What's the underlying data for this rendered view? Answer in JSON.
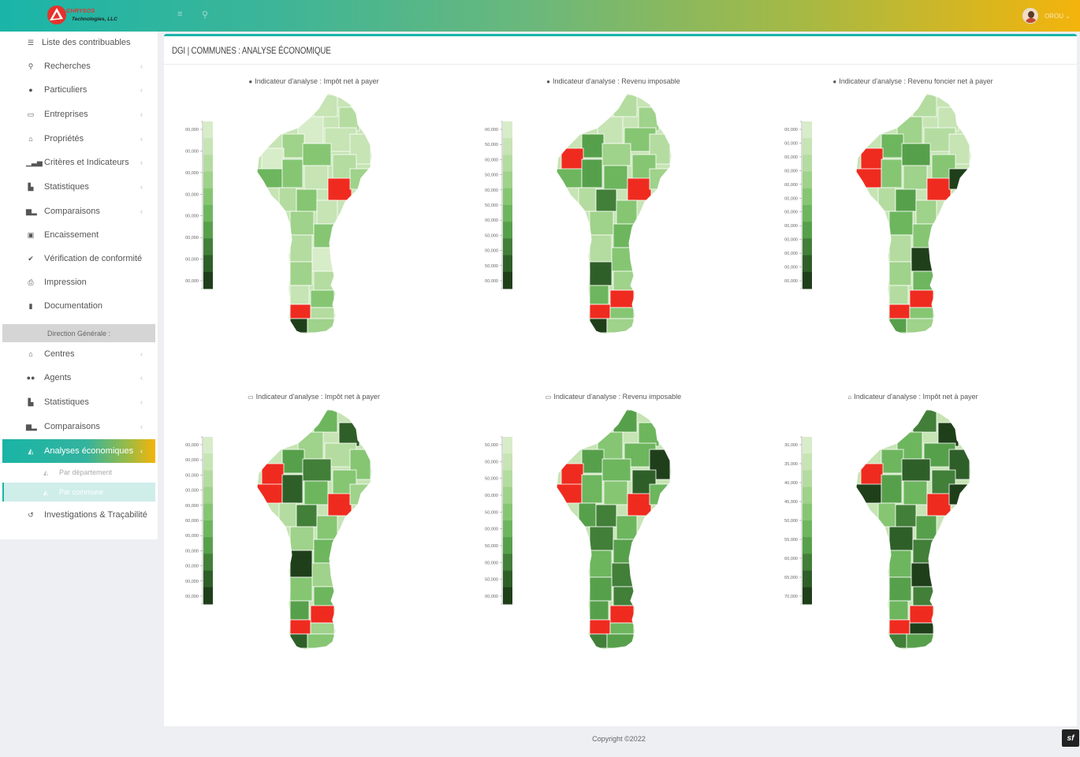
{
  "header": {
    "logo_line1": "CHRYSOS",
    "logo_line2": "Technologies, LLC",
    "menu_icon": "bars-icon",
    "search_icon": "search-icon",
    "user_name": "OROU",
    "user_caret": "⌄"
  },
  "sidebar": {
    "items": [
      {
        "label": "Liste des contribuables",
        "icon": "list-icon",
        "chevron": false
      },
      {
        "label": "Recherches",
        "icon": "search-icon",
        "chevron": true
      },
      {
        "label": "Particuliers",
        "icon": "user-icon",
        "chevron": true
      },
      {
        "label": "Entreprises",
        "icon": "desktop-icon",
        "chevron": true
      },
      {
        "label": "Propriétés",
        "icon": "home-icon",
        "chevron": true
      },
      {
        "label": "Critères et Indicateurs",
        "icon": "signal-icon",
        "chevron": true
      },
      {
        "label": "Statistiques",
        "icon": "bar-chart-icon",
        "chevron": true
      },
      {
        "label": "Comparaisons",
        "icon": "bar-compare-icon",
        "chevron": true
      },
      {
        "label": "Encaissement",
        "icon": "money-icon",
        "chevron": false
      },
      {
        "label": "Vérification de conformité",
        "icon": "check-circle-icon",
        "chevron": false
      },
      {
        "label": "Impression",
        "icon": "print-icon",
        "chevron": false
      },
      {
        "label": "Documentation",
        "icon": "bookmark-icon",
        "chevron": false
      }
    ],
    "section_label": "Direction Générale :",
    "items2": [
      {
        "label": "Centres",
        "icon": "bank-icon",
        "chevron": true
      },
      {
        "label": "Agents",
        "icon": "users-icon",
        "chevron": true
      },
      {
        "label": "Statistiques",
        "icon": "bar-chart-icon",
        "chevron": true
      },
      {
        "label": "Comparaisons",
        "icon": "bar-compare-icon",
        "chevron": true
      }
    ],
    "active_item": {
      "label": "Analyses économiques",
      "icon": "area-chart-icon"
    },
    "sub_items": [
      {
        "label": "Par département",
        "icon": "area-chart-icon"
      },
      {
        "label": "Par commune",
        "icon": "area-chart-icon"
      }
    ],
    "last_item": {
      "label": "Investigations & Traçabilité",
      "icon": "history-icon"
    }
  },
  "page": {
    "title": "DGI | COMMUNES : ANALYSE ÉCONOMIQUE"
  },
  "maps": [
    {
      "title": "Indicateur d'analyse : Impôt net à payer",
      "icon": "user-icon",
      "ticks": [
        "00,000",
        "00,000",
        "00,000",
        "00,000",
        "00,000",
        "00,000",
        "00,000",
        "00,000"
      ]
    },
    {
      "title": "Indicateur d'analyse : Revenu imposable",
      "icon": "user-icon",
      "ticks": [
        "00,000",
        "50,000",
        "00,000",
        "50,000",
        "00,000",
        "50,000",
        "00,000",
        "50,000",
        "00,000",
        "50,000",
        "00,000"
      ]
    },
    {
      "title": "Indicateur d'analyse : Revenu foncier net à payer",
      "icon": "user-icon",
      "ticks": [
        "00,000",
        "00,000",
        "00,000",
        "00,000",
        "00,000",
        "00,000",
        "00,000",
        "00,000",
        "00,000",
        "00,000",
        "00,000",
        "00,000"
      ]
    },
    {
      "title": "Indicateur d'analyse : Impôt net à payer",
      "icon": "desktop-icon",
      "ticks": [
        "00,000",
        "00,000",
        "00,000",
        "00,000",
        "00,000",
        "00,000",
        "00,000",
        "00,000",
        "00,000",
        "00,000",
        "00,000"
      ]
    },
    {
      "title": "Indicateur d'analyse : Revenu imposable",
      "icon": "desktop-icon",
      "ticks": [
        "50,000",
        "00,000",
        "50,000",
        "00,000",
        "50,000",
        "00,000",
        "50,000",
        "00,000",
        "50,000",
        "00,000"
      ]
    },
    {
      "title": "Indicateur d'analyse : Impôt net à payer",
      "icon": "home-icon",
      "ticks": [
        "30,000",
        "35,000",
        "40,000",
        "45,000",
        "50,000",
        "55,000",
        "60,000",
        "65,000",
        "70,000"
      ]
    }
  ],
  "colors": {
    "accent": "#1ab5a8",
    "gradient_end": "#f4b40c",
    "legend_light": "#d6ecc9",
    "legend_dark": "#1f3a17",
    "highlight": "#ef2b1f"
  },
  "footer": {
    "copyright": "Copyright ©2022",
    "badge": "sf"
  }
}
